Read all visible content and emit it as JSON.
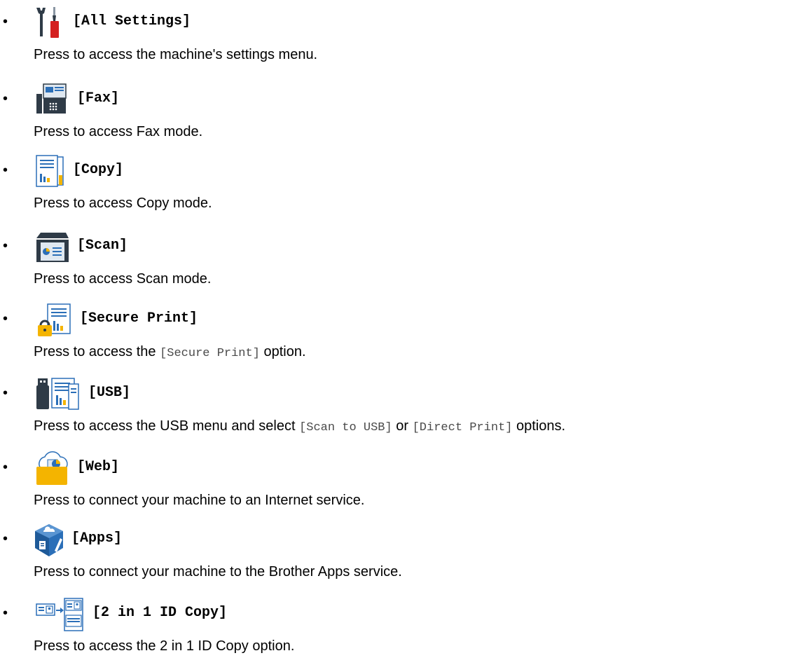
{
  "items": [
    {
      "icon": "all-settings-icon",
      "label": "[All Settings]",
      "desc": "Press to access the machine's settings menu."
    },
    {
      "icon": "fax-icon",
      "label": "[Fax]",
      "desc": "Press to access Fax mode."
    },
    {
      "icon": "copy-icon",
      "label": "[Copy]",
      "desc": "Press to access Copy mode."
    },
    {
      "icon": "scan-icon",
      "label": "[Scan]",
      "desc": "Press to access Scan mode."
    },
    {
      "icon": "secure-print-icon",
      "label": "[Secure Print]",
      "desc_before": "Press to access the ",
      "desc_code": "[Secure Print]",
      "desc_after": " option."
    },
    {
      "icon": "usb-icon",
      "label": "[USB]",
      "desc_before": "Press to access the USB menu and select ",
      "desc_code1": "[Scan to USB]",
      "desc_middle": " or ",
      "desc_code2": "[Direct Print]",
      "desc_after": " options."
    },
    {
      "icon": "web-icon",
      "label": "[Web]",
      "desc": "Press to connect your machine to an Internet service."
    },
    {
      "icon": "apps-icon",
      "label": "[Apps]",
      "desc": "Press to connect your machine to the Brother Apps service."
    },
    {
      "icon": "id-copy-icon",
      "label": "[2 in 1 ID Copy]",
      "desc": "Press to access the 2 in 1 ID Copy option."
    }
  ],
  "colors": {
    "text": "#000000",
    "code_text": "#4a4a4a",
    "icon_blue": "#2b6fb8",
    "icon_dark": "#2f3b47",
    "icon_red": "#d42020",
    "icon_yellow": "#f4b400",
    "icon_light": "#dfe8f1"
  }
}
